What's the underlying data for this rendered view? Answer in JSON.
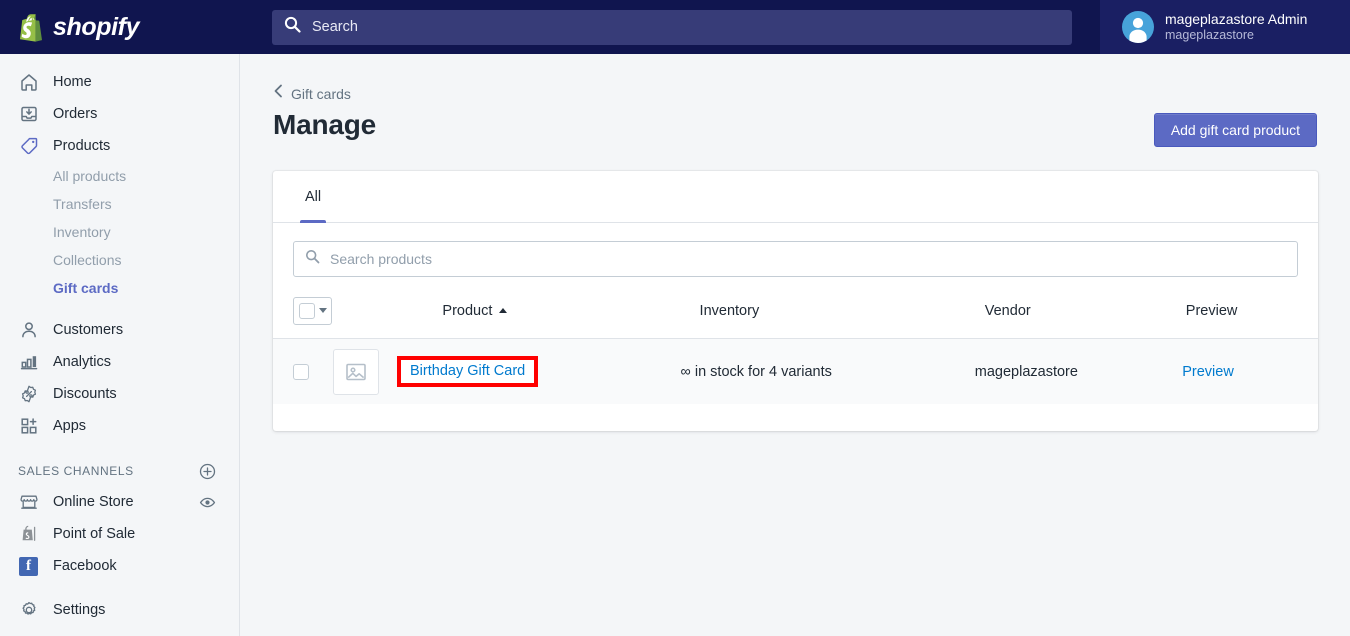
{
  "topbar": {
    "brand": "shopify",
    "search": {
      "placeholder": "Search",
      "icon": "search-icon"
    },
    "user": {
      "name": "mageplazastore Admin",
      "store": "mageplazastore",
      "avatar_icon": "user-avatar-icon"
    }
  },
  "sidebar": {
    "items": [
      {
        "label": "Home",
        "icon": "home-icon",
        "active": false
      },
      {
        "label": "Orders",
        "icon": "orders-inbox-icon",
        "active": false
      },
      {
        "label": "Products",
        "icon": "products-tag-icon",
        "active": true
      }
    ],
    "sub_items": [
      {
        "label": "All products",
        "selected": false
      },
      {
        "label": "Transfers",
        "selected": false
      },
      {
        "label": "Inventory",
        "selected": false
      },
      {
        "label": "Collections",
        "selected": false
      },
      {
        "label": "Gift cards",
        "selected": true
      }
    ],
    "items2": [
      {
        "label": "Customers",
        "icon": "customers-person-icon"
      },
      {
        "label": "Analytics",
        "icon": "analytics-bar-chart-icon"
      },
      {
        "label": "Discounts",
        "icon": "discounts-percent-badge-icon"
      },
      {
        "label": "Apps",
        "icon": "apps-grid-plus-icon"
      }
    ],
    "channels_header": {
      "label": "SALES CHANNELS",
      "add_icon": "plus-circle-icon"
    },
    "channels": [
      {
        "label": "Online Store",
        "icon": "online-store-icon",
        "trailing_icon": "eye-icon"
      },
      {
        "label": "Point of Sale",
        "icon": "point-of-sale-bag-icon",
        "trailing_icon": ""
      },
      {
        "label": "Facebook",
        "icon": "facebook-icon",
        "trailing_icon": ""
      }
    ],
    "settings": {
      "label": "Settings",
      "icon": "gear-icon"
    }
  },
  "main": {
    "breadcrumb": {
      "label": "Gift cards",
      "icon": "chevron-left-icon"
    },
    "title": "Manage",
    "primary_button": "Add gift card product",
    "tabs": [
      {
        "label": "All",
        "active": true
      }
    ],
    "product_search": {
      "placeholder": "Search products",
      "value": "",
      "icon": "search-icon"
    },
    "table": {
      "bulk_select": {
        "checked": false,
        "caret_icon": "chevron-down-icon"
      },
      "columns": [
        {
          "key": "product",
          "label": "Product",
          "sort": "asc",
          "sort_icon": "caret-up-icon"
        },
        {
          "key": "inventory",
          "label": "Inventory"
        },
        {
          "key": "vendor",
          "label": "Vendor"
        },
        {
          "key": "preview",
          "label": "Preview"
        }
      ],
      "rows": [
        {
          "selected": false,
          "thumbnail_icon": "image-placeholder-icon",
          "product": "Birthday Gift Card",
          "inventory": "∞ in stock for 4 variants",
          "vendor": "mageplazastore",
          "preview": "Preview",
          "highlight": true
        }
      ]
    }
  },
  "colors": {
    "brand_navy": "#10154f",
    "accent_indigo": "#5c6ac4",
    "link_blue": "#007ace",
    "annotation_red": "#ff0000",
    "page_bg": "#f4f6f8",
    "row_bg": "#f9fafb"
  }
}
